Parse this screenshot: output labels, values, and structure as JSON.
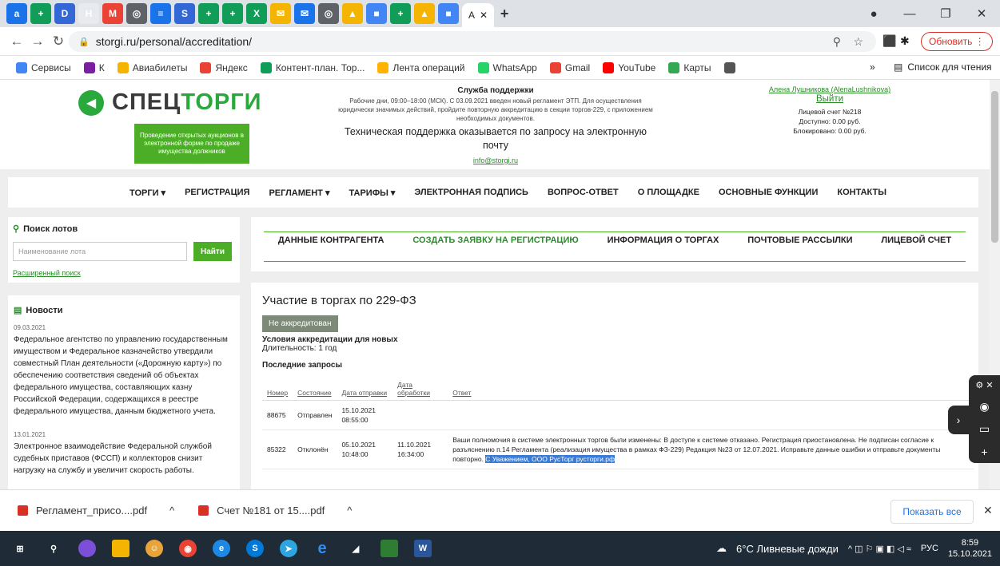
{
  "browser": {
    "tabs": [
      {
        "letter": "a",
        "color": "#1a73e8"
      },
      {
        "letter": "+",
        "color": "#0f9d58"
      },
      {
        "letter": "D",
        "color": "#3367d6"
      },
      {
        "letter": "H",
        "color": "#e8eaed"
      },
      {
        "letter": "M",
        "color": "#ea4335"
      },
      {
        "letter": "◎",
        "color": "#5f6368"
      },
      {
        "letter": "≡",
        "color": "#1a73e8"
      },
      {
        "letter": "S",
        "color": "#3367d6"
      },
      {
        "letter": "+",
        "color": "#0f9d58"
      },
      {
        "letter": "+",
        "color": "#0f9d58"
      },
      {
        "letter": "X",
        "color": "#0f9d58"
      },
      {
        "letter": "✉",
        "color": "#f4b400"
      },
      {
        "letter": "✉",
        "color": "#1a73e8"
      },
      {
        "letter": "◎",
        "color": "#5f6368"
      },
      {
        "letter": "▲",
        "color": "#f4b400"
      },
      {
        "letter": "■",
        "color": "#4285f4"
      },
      {
        "letter": "+",
        "color": "#0f9d58"
      },
      {
        "letter": "▲",
        "color": "#f4b400"
      },
      {
        "letter": "■",
        "color": "#4285f4"
      }
    ],
    "active_tab_label": "A",
    "new_tab": "+",
    "url": "storgi.ru/personal/accreditation/",
    "update_button": "Обновить",
    "bookmarks": [
      {
        "label": "Сервисы",
        "color": "#4285f4"
      },
      {
        "label": "К",
        "color": "#7b1fa2"
      },
      {
        "label": "Авиабилеты",
        "color": "#f4b400"
      },
      {
        "label": "Яндекс",
        "color": "#ea4335"
      },
      {
        "label": "Контент-план. Тор...",
        "color": "#0f9d58"
      },
      {
        "label": "Лента операций",
        "color": "#ffb300"
      },
      {
        "label": "WhatsApp",
        "color": "#25d366"
      },
      {
        "label": "Gmail",
        "color": "#ea4335"
      },
      {
        "label": "YouTube",
        "color": "#ff0000"
      },
      {
        "label": "Карты",
        "color": "#34a853"
      },
      {
        "label": "",
        "color": "#555555"
      }
    ],
    "reading_list": "Список для чтения"
  },
  "site": {
    "logo_dark": "СПЕЦ",
    "logo_green": "ТОРГИ",
    "slogan": "Проведение открытых аукционов в электронной форме по продаже имущества должников",
    "support_title": "Служба поддержки",
    "support_text": "Рабочие дни, 09:00–18:00 (МСК). С 03.09.2021 введен новый регламент ЭТП. Для осуществления юридически значимых действий, пройдите повторную аккредитацию в секции торгов-229, с приложением необходимых документов.",
    "support_big": "Техническая поддержка оказывается по запросу на электронную почту",
    "support_email": "info@storgi.ru",
    "user_name": "Алена Лушникова (AlenaLushnikova)",
    "logout": "Выйти",
    "account_no": "Лицевой счет №218",
    "available": "Доступно: 0.00 руб.",
    "blocked": "Блокировано: 0.00 руб.",
    "menu": [
      "ТОРГИ ▾",
      "РЕГИСТРАЦИЯ",
      "РЕГЛАМЕНТ ▾",
      "ТАРИФЫ ▾",
      "ЭЛЕКТРОННАЯ ПОДПИСЬ",
      "ВОПРОС-ОТВЕТ",
      "О ПЛОЩАДКЕ",
      "ОСНОВНЫЕ ФУНКЦИИ",
      "КОНТАКТЫ"
    ],
    "search_title": "Поиск лотов",
    "search_placeholder": "Наименование лота",
    "search_button": "Найти",
    "advanced_search": "Расширенный поиск",
    "subnav": [
      "ДАННЫЕ КОНТРАГЕНТА",
      "СОЗДАТЬ ЗАЯВКУ НА РЕГИСТРАЦИЮ",
      "ИНФОРМАЦИЯ О ТОРГАХ",
      "ПОЧТОВЫЕ РАССЫЛКИ",
      "ЛИЦЕВОЙ СЧЕТ"
    ],
    "news_title": "Новости",
    "news": [
      {
        "date": "09.03.2021",
        "text": "Федеральное агентство по управлению государственным имуществом и Федеральное казначейство утвердили совместный План деятельности («Дорожную карту») по обеспечению соответствия сведений об объектах федерального имущества, составляющих казну Российской Федерации, содержащихся в реестре федерального имущества, данным бюджетного учета."
      },
      {
        "date": "13.01.2021",
        "text": "Электронное взаимодействие Федеральной службой судебных приставов (ФССП) и коллекторов снизит нагрузку на службу и увеличит скорость работы."
      }
    ],
    "page_title": "Участие в торгах по 229-ФЗ",
    "status_badge": "Не аккредитован",
    "conditions": "Условия аккредитации для новых",
    "duration": "Длительность: 1 год",
    "recent": "Последние запросы",
    "columns": [
      "Номер",
      "Состояние",
      "Дата отправки",
      "Дата обработки",
      "Ответ"
    ],
    "rows": [
      {
        "num": "88675",
        "state": "Отправлен",
        "sent": "15.10.2021 08:55:00",
        "processed": "",
        "answer": "",
        "hl": ""
      },
      {
        "num": "85322",
        "state": "Отклонён",
        "sent": "05.10.2021 10:48:00",
        "processed": "11.10.2021 16:34:00",
        "answer": "Ваши полномочия в системе электронных торгов были изменены: В доступе к системе отказано. Регистрация приостановлена. Не подписан согласие к разъяснению п.14 Регламента (реализация имущества в рамках ФЗ-229) Редакция №23 от 12.07.2021. Исправьте данные ошибки и отправьте документы повторно.",
        "hl": "С Уважением, ООО РусТорг русторги.рф"
      }
    ]
  },
  "downloads": {
    "items": [
      "Регламент_присо....pdf",
      "Счет №181 от 15....pdf"
    ],
    "show_all": "Показать все"
  },
  "taskbar": {
    "weather": "6°C Ливневые дожди",
    "lang": "РУС",
    "time": "8:59",
    "date": "15.10.2021"
  }
}
